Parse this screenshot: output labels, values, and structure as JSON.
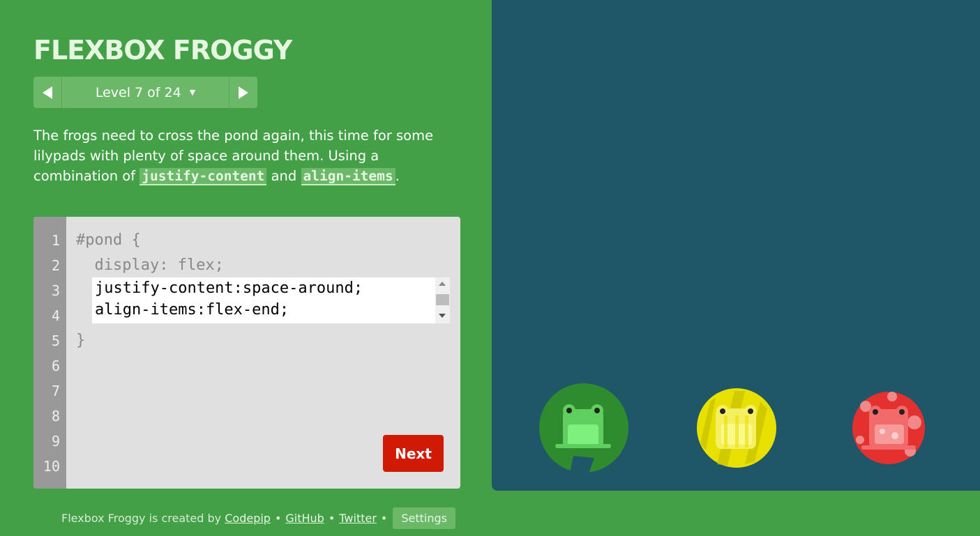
{
  "game": {
    "title": "FLEXBOX FROGGY",
    "level_label": "Level 7 of 24",
    "instructions": {
      "part1": "The frogs need to cross the pond again, this time for some lilypads with plenty of space around them. Using a combination of ",
      "code1": "justify-content",
      "part2": " and ",
      "code2": "align-items",
      "part3": "."
    }
  },
  "editor": {
    "line_numbers": [
      "1",
      "2",
      "3",
      "4",
      "5",
      "6",
      "7",
      "8",
      "9",
      "10"
    ],
    "line1": "#pond {",
    "line2": "  display: flex;",
    "input_value": "justify-content:space-around;\nalign-items:flex-end;",
    "line5": "}",
    "next_label": "Next"
  },
  "footer": {
    "credit_text": "Flexbox Froggy is created by",
    "codepip": "Codepip",
    "github": "GitHub",
    "twitter": "Twitter",
    "settings": "Settings"
  },
  "pond": {
    "background_color": "#1f5768",
    "frogs": [
      {
        "color": "green",
        "hex": "#2e8b2e"
      },
      {
        "color": "yellow",
        "hex": "#e8e000"
      },
      {
        "color": "red",
        "hex": "#e53030"
      }
    ]
  }
}
